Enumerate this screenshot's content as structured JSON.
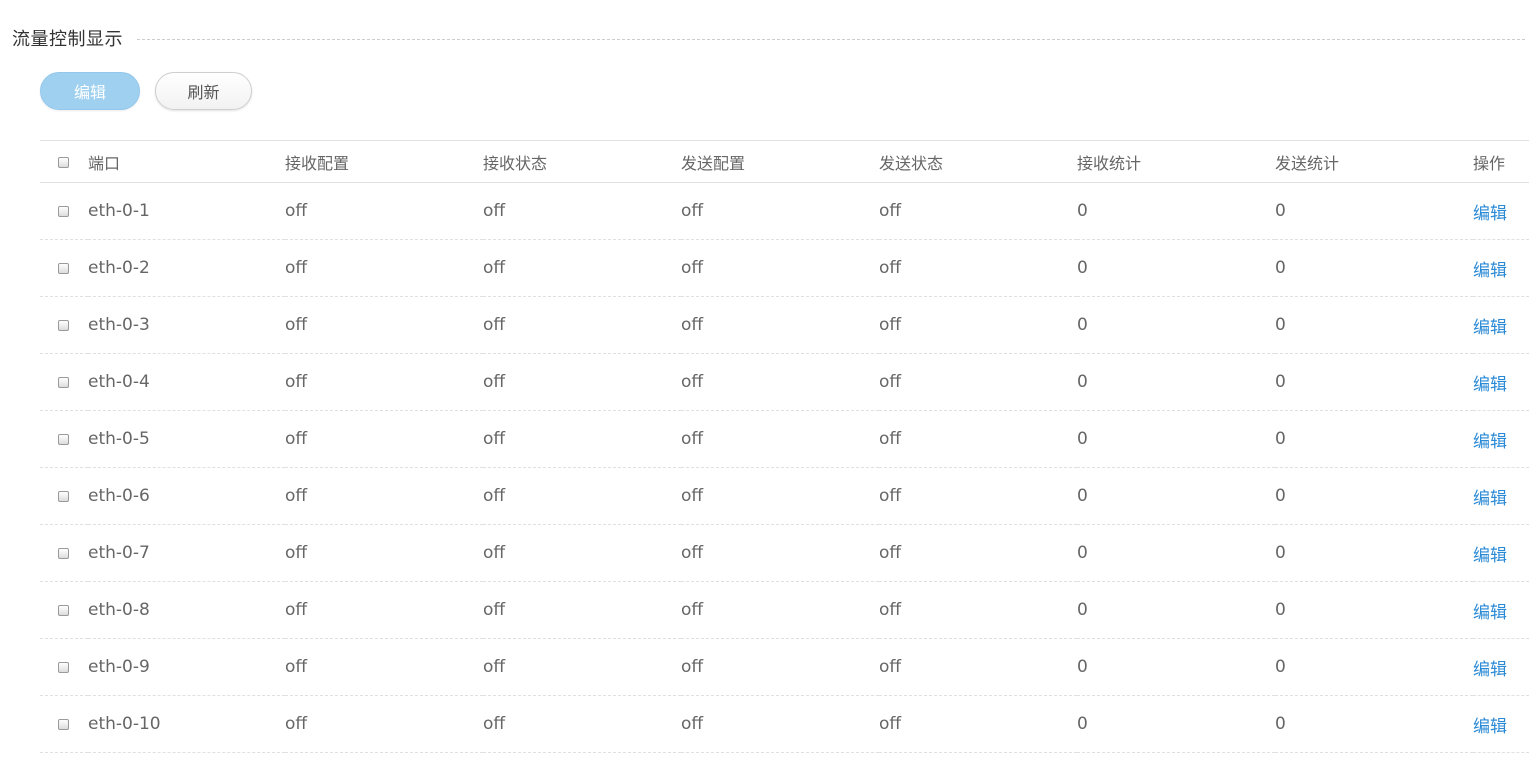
{
  "section": {
    "title": "流量控制显示"
  },
  "toolbar": {
    "edit_label": "编辑",
    "refresh_label": "刷新"
  },
  "colors": {
    "edit_button_bg": "#9fd0f0",
    "link": "#2b8ad6"
  },
  "table": {
    "columns": [
      "端口",
      "接收配置",
      "接收状态",
      "发送配置",
      "发送状态",
      "接收统计",
      "发送统计",
      "操作"
    ],
    "rows": [
      {
        "port": "eth-0-1",
        "rx_config": "off",
        "rx_status": "off",
        "tx_config": "off",
        "tx_status": "off",
        "rx_stats": "0",
        "tx_stats": "0",
        "action": "编辑"
      },
      {
        "port": "eth-0-2",
        "rx_config": "off",
        "rx_status": "off",
        "tx_config": "off",
        "tx_status": "off",
        "rx_stats": "0",
        "tx_stats": "0",
        "action": "编辑"
      },
      {
        "port": "eth-0-3",
        "rx_config": "off",
        "rx_status": "off",
        "tx_config": "off",
        "tx_status": "off",
        "rx_stats": "0",
        "tx_stats": "0",
        "action": "编辑"
      },
      {
        "port": "eth-0-4",
        "rx_config": "off",
        "rx_status": "off",
        "tx_config": "off",
        "tx_status": "off",
        "rx_stats": "0",
        "tx_stats": "0",
        "action": "编辑"
      },
      {
        "port": "eth-0-5",
        "rx_config": "off",
        "rx_status": "off",
        "tx_config": "off",
        "tx_status": "off",
        "rx_stats": "0",
        "tx_stats": "0",
        "action": "编辑"
      },
      {
        "port": "eth-0-6",
        "rx_config": "off",
        "rx_status": "off",
        "tx_config": "off",
        "tx_status": "off",
        "rx_stats": "0",
        "tx_stats": "0",
        "action": "编辑"
      },
      {
        "port": "eth-0-7",
        "rx_config": "off",
        "rx_status": "off",
        "tx_config": "off",
        "tx_status": "off",
        "rx_stats": "0",
        "tx_stats": "0",
        "action": "编辑"
      },
      {
        "port": "eth-0-8",
        "rx_config": "off",
        "rx_status": "off",
        "tx_config": "off",
        "tx_status": "off",
        "rx_stats": "0",
        "tx_stats": "0",
        "action": "编辑"
      },
      {
        "port": "eth-0-9",
        "rx_config": "off",
        "rx_status": "off",
        "tx_config": "off",
        "tx_status": "off",
        "rx_stats": "0",
        "tx_stats": "0",
        "action": "编辑"
      },
      {
        "port": "eth-0-10",
        "rx_config": "off",
        "rx_status": "off",
        "tx_config": "off",
        "tx_status": "off",
        "rx_stats": "0",
        "tx_stats": "0",
        "action": "编辑"
      }
    ]
  }
}
